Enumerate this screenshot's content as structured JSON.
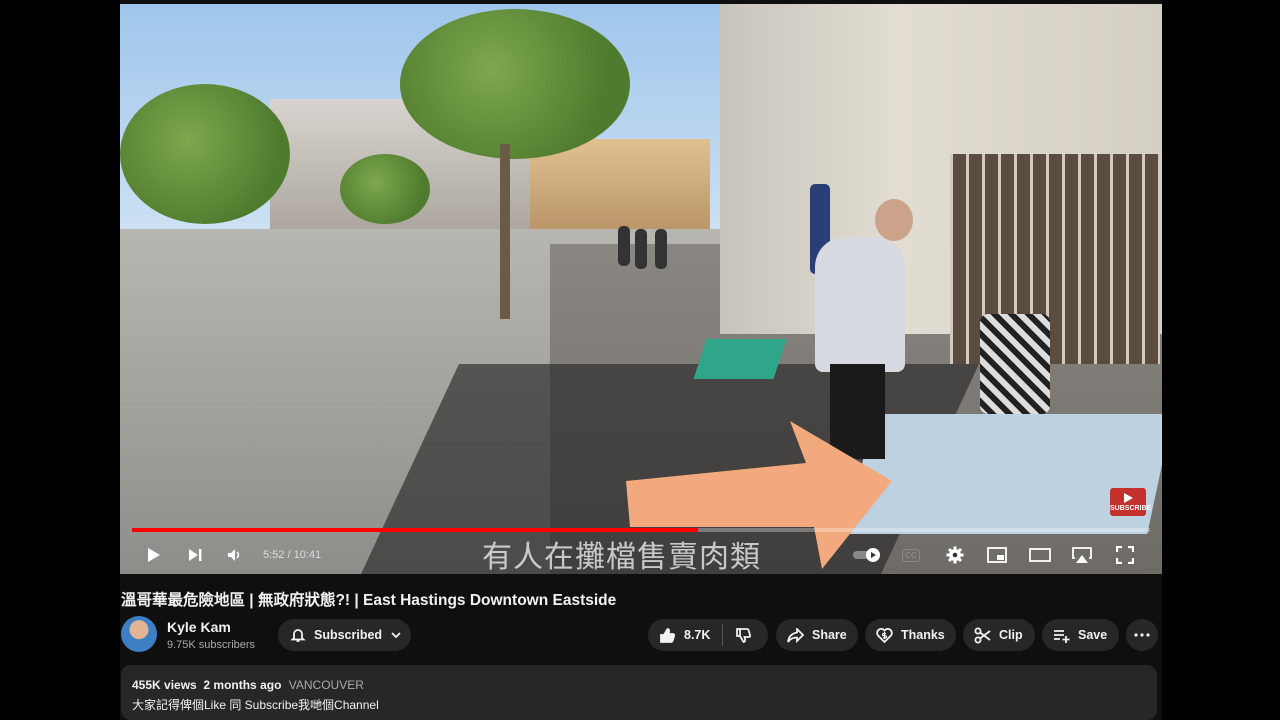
{
  "video": {
    "caption": "有人在攤檔售賣肉類",
    "badge": "SUBSCRIBE",
    "progress_fraction": 0.556
  },
  "player": {
    "current_time": "5:52",
    "time_sep": " / ",
    "duration": "10:41",
    "cc_label": "CC"
  },
  "title": "溫哥華最危險地區 | 無政府狀態?! | East Hastings Downtown Eastside",
  "channel": {
    "name": "Kyle Kam",
    "subscribers": "9.75K subscribers",
    "subscribe_label": "Subscribed"
  },
  "actions": {
    "likes": "8.7K",
    "share": "Share",
    "thanks": "Thanks",
    "clip": "Clip",
    "save": "Save"
  },
  "description": {
    "views": "455K views",
    "age": "2 months ago",
    "tag": "VANCOUVER",
    "text": "大家記得俾個Like 同 Subscribe我哋個Channel"
  },
  "colors": {
    "progress": "#ff0000",
    "arrow": "#f3a97e",
    "page_bg": "#0f0f0f",
    "pill_bg": "#272727"
  }
}
